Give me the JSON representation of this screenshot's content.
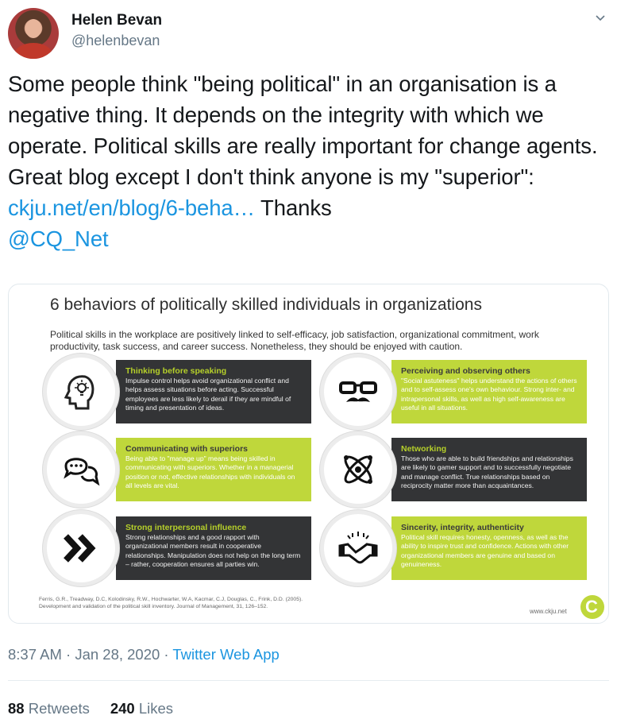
{
  "author": {
    "name": "Helen Bevan",
    "handle": "@helenbevan"
  },
  "tweet": {
    "text_before": "Some people think \"being political\" in an organisation is a negative thing. It depends on the integrity with which we operate. Political skills are really important for change agents. Great blog except I don't think anyone is my \"superior\": ",
    "link": "ckju.net/en/blog/6-beha…",
    "text_mid": " Thanks ",
    "mention": "@CQ_Net"
  },
  "infographic": {
    "title": "6 behaviors of politically skilled individuals in organizations",
    "intro": "Political skills in the workplace are positively linked to self-efficacy, job satisfaction, organizational commitment, work productivity, task success, and career success. Nonetheless, they should be enjoyed with caution.",
    "items": [
      {
        "title": "Thinking before speaking",
        "body": "Impulse control helps avoid organizational conflict and helps assess situations before acting. Successful employees are less likely to derail if they are mindful of timing and presentation of ideas.",
        "icon": "head-idea-icon"
      },
      {
        "title": "Perceiving and observing others",
        "body": "\"Social astuteness\" helps understand the actions of others and to self-assess one's own behaviour. Strong inter- and intrapersonal skills, as well as high self-awareness are useful in all situations.",
        "icon": "glasses-mustache-icon"
      },
      {
        "title": "Communicating with superiors",
        "body": "Being able to \"manage up\" means being skilled in communicating with superiors. Whether in a managerial position or not, effective relationships with individuals on all levels are vital.",
        "icon": "speech-bubbles-icon"
      },
      {
        "title": "Networking",
        "body": "Those who are able to build friendships and relationships are likely to gamer support and to successfully negotiate and manage conflict. True relationships based on reciprocity matter more than acquaintances.",
        "icon": "network-atom-icon"
      },
      {
        "title": "Strong interpersonal influence",
        "body": "Strong relationships and a good rapport with organizational members result in cooperative relationships. Manipulation does not help on the long term – rather, cooperation ensures all parties win.",
        "icon": "double-chevron-icon"
      },
      {
        "title": "Sincerity, integrity, authenticity",
        "body": "Political skill requires honesty, openness, as well as the ability to inspire trust and confidence. Actions with other organizational members are genuine and based on genuineness.",
        "icon": "handshake-icon"
      }
    ],
    "reference_line1": "Ferris, G.R., Treadway, D.C, Kolodinsky, R.W., Hochwarter, W.A, Kacmar, C.J, Douglas, C., Frink, D.D. (2005).",
    "reference_line2": "Development and validation of the political skill inventory. Journal of Management, 31, 126–152.",
    "url": "www.ckju.net",
    "logo_letter": "C"
  },
  "meta": {
    "time": "8:37 AM · Jan 28, 2020 · ",
    "source": "Twitter Web App"
  },
  "stats": {
    "retweets_count": "88",
    "retweets_label": "Retweets",
    "likes_count": "240",
    "likes_label": "Likes"
  },
  "colors": {
    "link": "#1b95e0",
    "lime": "#bfd73b",
    "dark": "#333436"
  }
}
